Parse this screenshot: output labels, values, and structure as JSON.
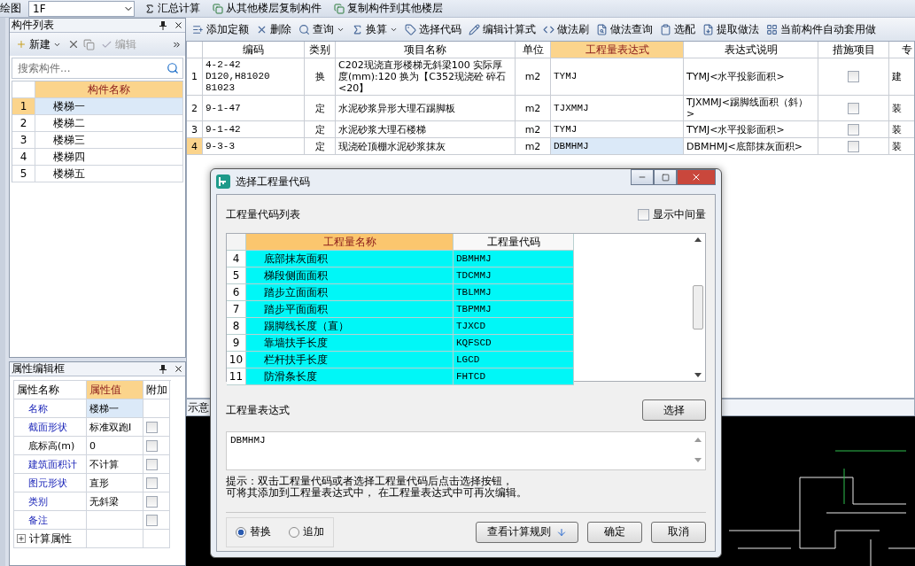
{
  "top_toolbar": {
    "partial_label": "绘图",
    "floor": "1F",
    "buttons": [
      "汇总计算",
      "从其他楼层复制构件",
      "复制构件到其他楼层"
    ]
  },
  "component_panel": {
    "title": "构件列表",
    "toolbar": [
      {
        "label": "新建",
        "disabled": false
      },
      {
        "label": "编辑",
        "disabled": true
      }
    ],
    "search": {
      "placeholder": "搜索构件..."
    },
    "column": "构件名称",
    "rows": [
      {
        "index": "1",
        "name": "楼梯一",
        "selected": true
      },
      {
        "index": "2",
        "name": "楼梯二",
        "selected": false
      },
      {
        "index": "3",
        "name": "楼梯三",
        "selected": false
      },
      {
        "index": "4",
        "name": "楼梯四",
        "selected": false
      },
      {
        "index": "5",
        "name": "楼梯五",
        "selected": false
      }
    ]
  },
  "property_panel": {
    "title": "属性编辑框",
    "columns": [
      "属性名称",
      "属性值",
      "附加"
    ],
    "rows": [
      {
        "name": "名称",
        "value": "楼梯一",
        "linked": true,
        "has_checkbox": false
      },
      {
        "name": "截面形状",
        "value": "标准双跑I",
        "linked": true,
        "has_checkbox": true
      },
      {
        "name": "底标高(m)",
        "value": "0",
        "linked": false,
        "has_checkbox": true
      },
      {
        "name": "建筑面积计",
        "value": "不计算",
        "linked": true,
        "has_checkbox": true
      },
      {
        "name": "图元形状",
        "value": "直形",
        "linked": true,
        "has_checkbox": true
      },
      {
        "name": "类别",
        "value": "无斜梁",
        "linked": true,
        "has_checkbox": true
      },
      {
        "name": "备注",
        "value": "",
        "linked": true,
        "has_checkbox": true
      }
    ],
    "group": {
      "label": "计算属性",
      "expanded": false
    }
  },
  "method_toolbar": [
    {
      "label": "添加定额",
      "dropdown": false
    },
    {
      "label": "删除",
      "dropdown": false
    },
    {
      "label": "查询",
      "dropdown": true
    },
    {
      "label": "换算",
      "dropdown": true
    },
    {
      "label": "选择代码",
      "dropdown": false
    },
    {
      "label": "编辑计算式",
      "dropdown": false
    },
    {
      "label": "做法刷",
      "dropdown": false
    },
    {
      "label": "做法查询",
      "dropdown": false
    },
    {
      "label": "选配",
      "dropdown": false
    },
    {
      "label": "提取做法",
      "dropdown": false
    },
    {
      "label": "当前构件自动套用做",
      "dropdown": false
    }
  ],
  "method_table": {
    "columns": [
      "编码",
      "类别",
      "项目名称",
      "单位",
      "工程量表达式",
      "表达式说明",
      "措施项目",
      "专"
    ],
    "rows": [
      {
        "index": "1",
        "code": "4-2-42 D120,H81020 81023",
        "type": "换",
        "name": "C202现浇直形楼梯无斜梁100 实际厚度(mm):120 换为【C352现浇砼 碎石<20】",
        "unit": "m2",
        "expr": "TYMJ",
        "desc": "TYMJ<水平投影面积>",
        "measure": false,
        "discipline": "建",
        "selected": false
      },
      {
        "index": "2",
        "code": "9-1-47",
        "type": "定",
        "name": "水泥砂浆异形大理石踢脚板",
        "unit": "m2",
        "expr": "TJXMMJ",
        "desc": "TJXMMJ<踢脚线面积（斜）>",
        "measure": false,
        "discipline": "装",
        "selected": false
      },
      {
        "index": "3",
        "code": "9-1-42",
        "type": "定",
        "name": "水泥砂浆大理石楼梯",
        "unit": "m2",
        "expr": "TYMJ",
        "desc": "TYMJ<水平投影面积>",
        "measure": false,
        "discipline": "装",
        "selected": false
      },
      {
        "index": "4",
        "code": "9-3-3",
        "type": "定",
        "name": "现浇砼顶棚水泥砂浆抹灰",
        "unit": "m2",
        "expr": "DBMHMJ",
        "desc": "DBMHMJ<底部抹灰面积>",
        "measure": false,
        "discipline": "装",
        "selected": true
      }
    ]
  },
  "preview": {
    "title": "示意"
  },
  "dialog": {
    "title": "选择工程量代码",
    "list_label": "工程量代码列表",
    "show_intermediate": {
      "label": "显示中间量",
      "checked": false
    },
    "columns": [
      "工程量名称",
      "工程量代码"
    ],
    "rows": [
      {
        "index": "4",
        "name": "底部抹灰面积",
        "code": "DBMHMJ"
      },
      {
        "index": "5",
        "name": "梯段侧面面积",
        "code": "TDCMMJ"
      },
      {
        "index": "6",
        "name": "踏步立面面积",
        "code": "TBLMMJ"
      },
      {
        "index": "7",
        "name": "踏步平面面积",
        "code": "TBPMMJ"
      },
      {
        "index": "8",
        "name": "踢脚线长度（直）",
        "code": "TJXCD"
      },
      {
        "index": "9",
        "name": "靠墙扶手长度",
        "code": "KQFSCD"
      },
      {
        "index": "10",
        "name": "栏杆扶手长度",
        "code": "LGCD"
      },
      {
        "index": "11",
        "name": "防滑条长度",
        "code": "FHTCD"
      }
    ],
    "expression_label": "工程量表达式",
    "select_button": "选择",
    "expression": "DBMHMJ",
    "hint": [
      "提示：双击工程量代码或者选择工程量代码后点击选择按钮，",
      "可将其添加到工程量表达式中， 在工程量表达式中可再次编辑。"
    ],
    "modes": [
      {
        "label": "替换",
        "selected": true
      },
      {
        "label": "追加",
        "selected": false
      }
    ],
    "buttons": [
      "查看计算规则",
      "确定",
      "取消"
    ]
  }
}
